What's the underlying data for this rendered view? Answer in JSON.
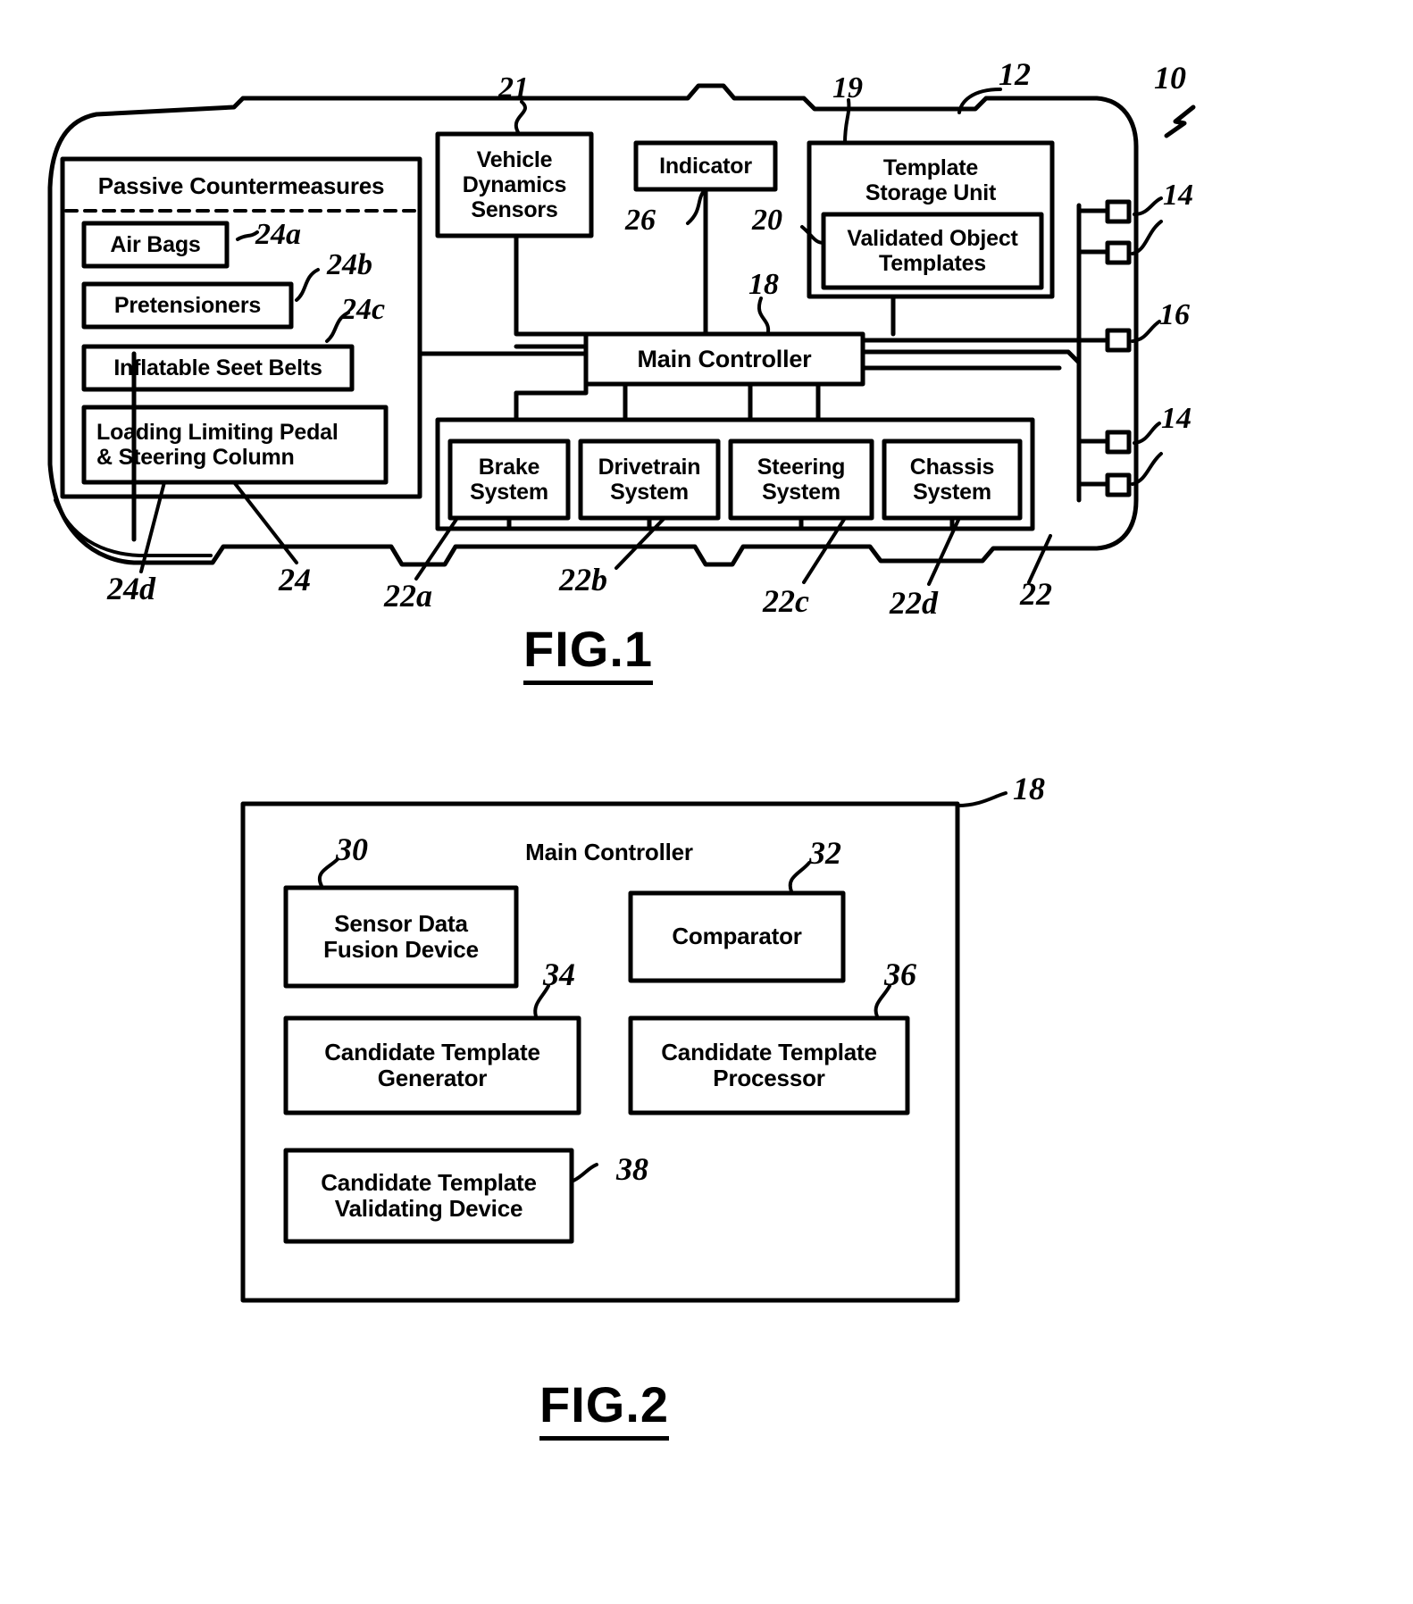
{
  "figures": [
    {
      "id": "fig1",
      "caption": "FIG.1",
      "system_ref": "10",
      "vehicle_ref": "12",
      "boxes": {
        "passive_countermeasures": "Passive Countermeasures",
        "air_bags": "Air Bags",
        "pretensioners": "Pretensioners",
        "inflatable_seat_belts": "Inflatable Seet Belts",
        "loading_limiting": "Loading Limiting Pedal\n& Steering Column",
        "vehicle_dynamics_sensors": "Vehicle\nDynamics\nSensors",
        "indicator": "Indicator",
        "template_storage_unit": "Template\nStorage Unit",
        "validated_object_templates": "Validated Object\nTemplates",
        "main_controller": "Main Controller",
        "brake_system": "Brake\nSystem",
        "drivetrain_system": "Drivetrain\nSystem",
        "steering_system": "Steering\nSystem",
        "chassis_system": "Chassis\nSystem"
      },
      "refs": {
        "air_bags": "24a",
        "pretensioners": "24b",
        "inflatable_seat_belts": "24c",
        "loading_limiting": "24d",
        "passive_countermeasures": "24",
        "vehicle_dynamics_sensors": "21",
        "indicator": "26",
        "template_storage_unit": "19",
        "validated_object_templates": "20",
        "main_controller": "18",
        "sensor_top": "14",
        "sensor_mid": "16",
        "sensor_bottom": "14",
        "brake_system": "22a",
        "drivetrain_system": "22b",
        "steering_system": "22c",
        "chassis_system": "22d",
        "active_systems": "22"
      }
    },
    {
      "id": "fig2",
      "caption": "FIG.2",
      "outer_ref": "18",
      "boxes": {
        "title": "Main Controller",
        "sensor_data_fusion_device": "Sensor Data\nFusion Device",
        "comparator": "Comparator",
        "candidate_template_generator": "Candidate Template\nGenerator",
        "candidate_template_processor": "Candidate Template\nProcessor",
        "candidate_template_validating_device": "Candidate Template\nValidating Device"
      },
      "refs": {
        "sensor_data_fusion_device": "30",
        "comparator": "32",
        "candidate_template_generator": "34",
        "candidate_template_processor": "36",
        "candidate_template_validating_device": "38"
      }
    }
  ],
  "colors": {
    "ink": "#000000",
    "paper": "#ffffff"
  }
}
